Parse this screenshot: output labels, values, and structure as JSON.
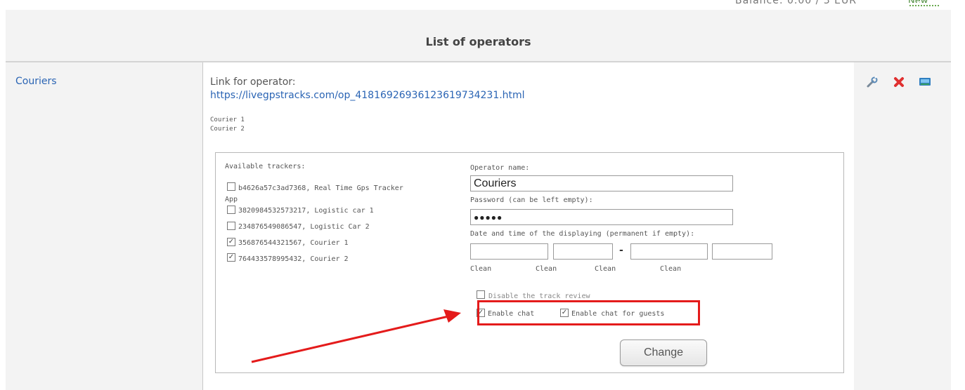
{
  "page": {
    "title": "List of operators"
  },
  "operator": {
    "name_link": "Couriers",
    "link_label": "Link for operator:",
    "link_url": "https://livegpstracks.com/op_41816926936123619734231.html",
    "couriers": [
      "Courier 1",
      "Courier 2"
    ]
  },
  "form": {
    "available_label": "Available trackers:",
    "trackers": [
      {
        "text": "b4626a57c3ad7368, Real Time Gps Tracker",
        "wrap": "App",
        "checked": false
      },
      {
        "text": "3820984532573217, Logistic car 1",
        "checked": false
      },
      {
        "text": "234876549086547, Logistic Car 2",
        "checked": false
      },
      {
        "text": "356876544321567, Courier 1",
        "checked": true
      },
      {
        "text": "764433578995432, Courier 2",
        "checked": true
      }
    ],
    "operator_name_label": "Operator name:",
    "operator_name_value": "Couriers",
    "password_label": "Password (can be left empty):",
    "password_value": "●●●●●",
    "datetime_label": "Date and time of the displaying (permanent if empty):",
    "dash": "-",
    "clean_labels": [
      "Clean",
      "Clean",
      "Clean",
      "Clean"
    ],
    "disable_track_review": {
      "label": "Disable the track review",
      "checked": false
    },
    "enable_chat": {
      "label": "Enable chat",
      "checked": true
    },
    "enable_chat_guests": {
      "label": "Enable chat for guests",
      "checked": true
    },
    "submit_label": "Change"
  },
  "icons": {
    "edit": "wrench-icon",
    "delete": "close-icon",
    "view": "monitor-icon"
  },
  "colors": {
    "highlight": "#e41b1b",
    "link": "#2a64b4",
    "delete": "#e03030"
  }
}
